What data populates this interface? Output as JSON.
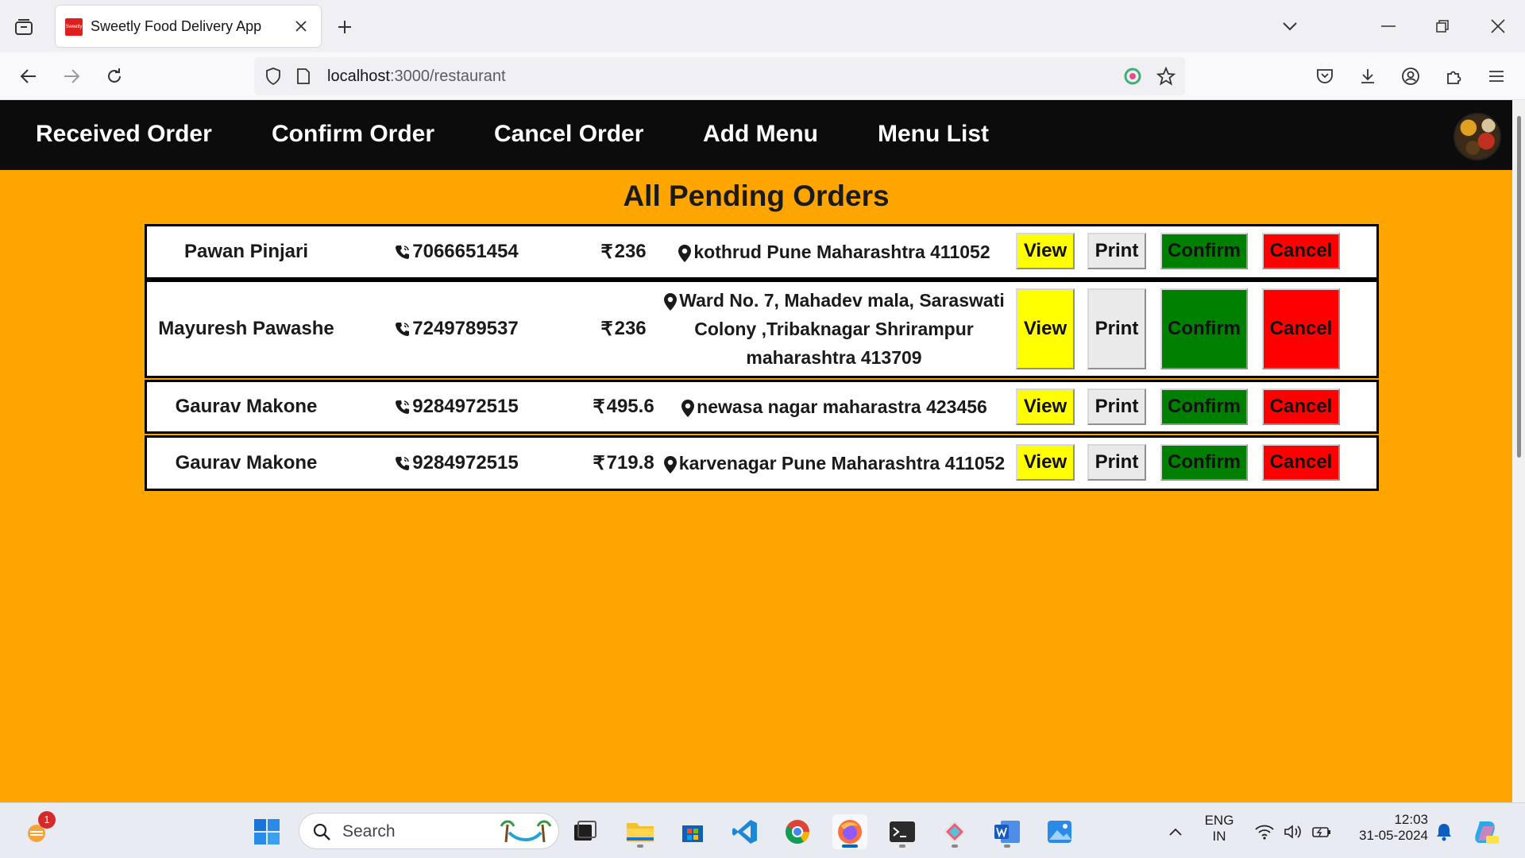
{
  "browser": {
    "tab_title": "Sweetly Food Delivery App",
    "favicon_text": "Sweetly",
    "url_host": "localhost",
    "url_path": ":3000/restaurant"
  },
  "app_nav": {
    "items": [
      "Received Order",
      "Confirm Order",
      "Cancel Order",
      "Add Menu",
      "Menu List"
    ]
  },
  "page_title": "All Pending Orders",
  "currency_symbol": "₹",
  "orders": [
    {
      "name": "Pawan Pinjari",
      "phone": "7066651454",
      "amount": "236",
      "address": "kothrud Pune Maharashtra 411052",
      "view_label": "View",
      "print_label": "Print",
      "confirm_label": "Confirm",
      "cancel_label": "Cancel"
    },
    {
      "name": "Mayuresh Pawashe",
      "phone": "7249789537",
      "amount": "236",
      "address": "Ward No. 7, Mahadev mala, Saraswati Colony ,Tribaknagar Shrirampur maharashtra 413709",
      "view_label": "View",
      "print_label": "Print",
      "confirm_label": "Confirm",
      "cancel_label": "Cancel"
    },
    {
      "name": "Gaurav Makone",
      "phone": "9284972515",
      "amount": "495.6",
      "address": "newasa nagar maharastra 423456",
      "view_label": "View",
      "print_label": "Print",
      "confirm_label": "Confirm",
      "cancel_label": "Cancel"
    },
    {
      "name": "Gaurav Makone",
      "phone": "9284972515",
      "amount": "719.8",
      "address": "karvenagar Pune Maharashtra 411052",
      "view_label": "View",
      "print_label": "Print",
      "confirm_label": "Confirm",
      "cancel_label": "Cancel"
    }
  ],
  "taskbar": {
    "search_placeholder": "Search",
    "notification_badge": "1",
    "language_line1": "ENG",
    "language_line2": "IN",
    "time": "12:03",
    "date": "31-05-2024"
  },
  "colors": {
    "page_background": "#ffa500",
    "app_nav_background": "#0c0c0c",
    "view_button": "#ffff00",
    "print_button": "#eaeaea",
    "confirm_button": "#008000",
    "cancel_button": "#ff0000"
  }
}
